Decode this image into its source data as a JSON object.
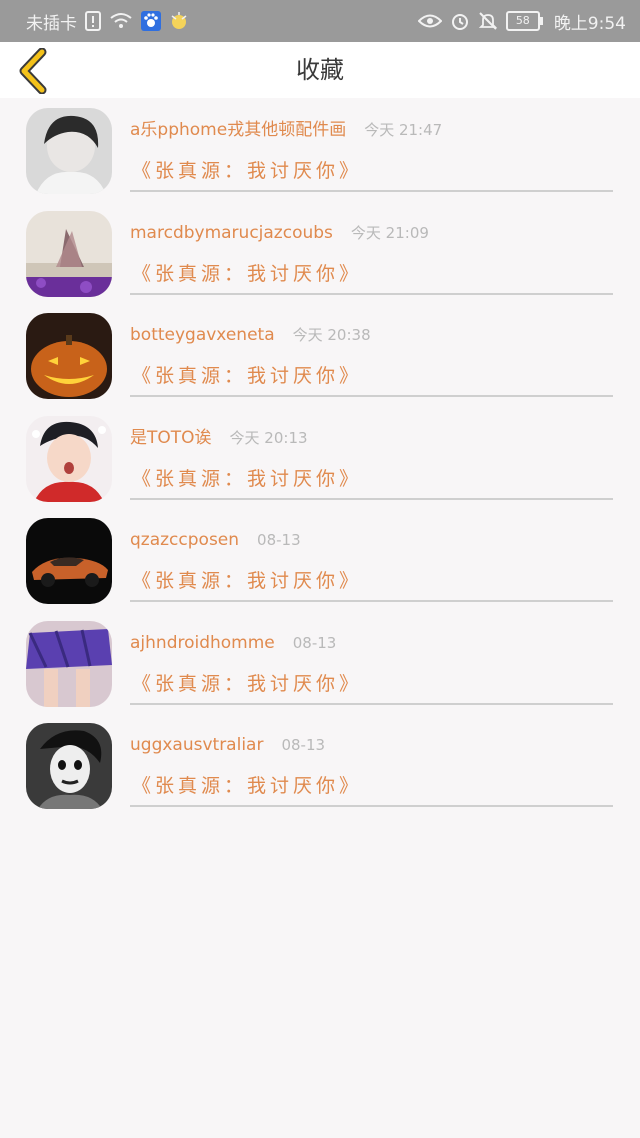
{
  "status_bar": {
    "carrier": "未插卡",
    "battery": "58",
    "time": "晚上9:54"
  },
  "header": {
    "title": "收藏",
    "back_icon": "chevron-left-icon"
  },
  "favorites": [
    {
      "user": "a乐pphome戎其他顿配件画",
      "time": "今天 21:47",
      "work": "《张真源：我讨厌你》",
      "avatar": "avatar-bw-portrait"
    },
    {
      "user": "marcdbymarucjazcoubs",
      "time": "今天 21:09",
      "work": "《张真源：我讨厌你》",
      "avatar": "avatar-butterfly"
    },
    {
      "user": "botteygavxeneta",
      "time": "今天 20:38",
      "work": "《张真源：我讨厌你》",
      "avatar": "avatar-pumpkin"
    },
    {
      "user": "是TOTO诶",
      "time": "今天 20:13",
      "work": "《张真源：我讨厌你》",
      "avatar": "avatar-boy"
    },
    {
      "user": "qzazccposen",
      "time": "08-13",
      "work": "《张真源：我讨厌你》",
      "avatar": "avatar-car"
    },
    {
      "user": "ajhndroidhomme",
      "time": "08-13",
      "work": "《张真源：我讨厌你》",
      "avatar": "avatar-skirt"
    },
    {
      "user": "uggxausvtraliar",
      "time": "08-13",
      "work": "《张真源：我讨厌你》",
      "avatar": "avatar-clown"
    }
  ],
  "colors": {
    "accent": "#e08a4e",
    "back_arrow": "#f4c21a",
    "status_bar": "#9a9a9a"
  }
}
